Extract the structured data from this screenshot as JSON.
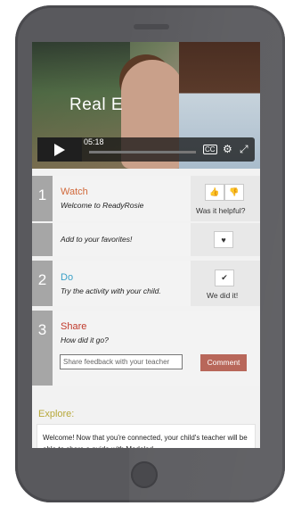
{
  "video": {
    "title": "Real E",
    "time": "05:18",
    "play_icon": "play-icon",
    "cc_icon": "cc-icon",
    "settings_icon": "gear-icon",
    "fullscreen_icon": "fullscreen-icon"
  },
  "watch": {
    "number": "1",
    "title": "Watch",
    "description": "Welcome to ReadyRosie",
    "helpful_label": "Was it helpful?",
    "thumbs_up_icon": "thumbs-up-icon",
    "thumbs_down_icon": "thumbs-down-icon"
  },
  "favorites": {
    "label": "Add to your favorites!",
    "heart_icon": "heart-icon"
  },
  "do": {
    "number": "2",
    "title": "Do",
    "description": "Try the activity with your child.",
    "did_it_label": "We did it!",
    "check_icon": "check-icon"
  },
  "share": {
    "number": "3",
    "title": "Share",
    "prompt": "How did it go?",
    "feedback_placeholder": "Share feedback with your teacher",
    "comment_button": "Comment"
  },
  "explore": {
    "title": "Explore:",
    "text": "Welcome! Now that you're connected, your child's teacher will be able to share a guide with Modeled"
  },
  "colors": {
    "watch": "#d1693b",
    "do": "#3ba0c7",
    "share": "#c0392b",
    "explore": "#b7a83a",
    "comment_button": "#b8675a"
  }
}
